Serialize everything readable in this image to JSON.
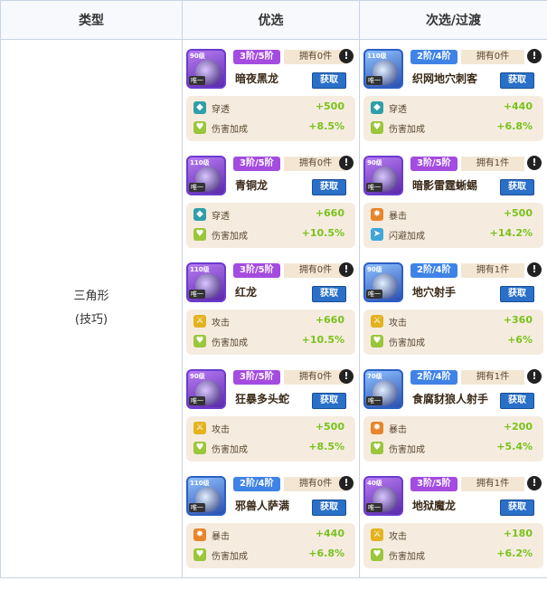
{
  "headers": {
    "type": "类型",
    "preferred": "优选",
    "alternative": "次选/过渡"
  },
  "type_label": {
    "line1": "三角形",
    "line2": "(技巧)"
  },
  "preferred": [
    {
      "level": "90级",
      "rank": "唯一",
      "tier": "3阶/5阶",
      "tier_color": "purple",
      "own": "拥有0件",
      "name": "暗夜黑龙",
      "get": "获取",
      "stats": [
        {
          "icon": "pierce-icon",
          "kind": "pen",
          "label": "穿透",
          "value": "+500"
        },
        {
          "icon": "damage-bonus-icon",
          "kind": "dmg",
          "label": "伤害加成",
          "value": "+8.5%"
        }
      ]
    },
    {
      "level": "110级",
      "rank": "唯一",
      "tier": "3阶/5阶",
      "tier_color": "purple",
      "own": "拥有0件",
      "name": "青铜龙",
      "get": "获取",
      "stats": [
        {
          "icon": "pierce-icon",
          "kind": "pen",
          "label": "穿透",
          "value": "+660"
        },
        {
          "icon": "damage-bonus-icon",
          "kind": "dmg",
          "label": "伤害加成",
          "value": "+10.5%"
        }
      ]
    },
    {
      "level": "110级",
      "rank": "唯一",
      "tier": "3阶/5阶",
      "tier_color": "purple",
      "own": "拥有0件",
      "name": "红龙",
      "get": "获取",
      "stats": [
        {
          "icon": "attack-icon",
          "kind": "atk",
          "label": "攻击",
          "value": "+660"
        },
        {
          "icon": "damage-bonus-icon",
          "kind": "dmg",
          "label": "伤害加成",
          "value": "+10.5%"
        }
      ]
    },
    {
      "level": "90级",
      "rank": "唯一",
      "tier": "3阶/5阶",
      "tier_color": "purple",
      "own": "拥有0件",
      "name": "狂暴多头蛇",
      "get": "获取",
      "stats": [
        {
          "icon": "attack-icon",
          "kind": "atk",
          "label": "攻击",
          "value": "+500"
        },
        {
          "icon": "damage-bonus-icon",
          "kind": "dmg",
          "label": "伤害加成",
          "value": "+8.5%"
        }
      ]
    },
    {
      "level": "110级",
      "rank": "唯一",
      "tier": "2阶/4阶",
      "tier_color": "blue",
      "own": "拥有0件",
      "name": "邪兽人萨满",
      "get": "获取",
      "stats": [
        {
          "icon": "crit-icon",
          "kind": "crit",
          "label": "暴击",
          "value": "+440"
        },
        {
          "icon": "damage-bonus-icon",
          "kind": "dmg",
          "label": "伤害加成",
          "value": "+6.8%"
        }
      ]
    }
  ],
  "alternative": [
    {
      "level": "110级",
      "rank": "唯一",
      "tier": "2阶/4阶",
      "tier_color": "blue",
      "own": "拥有0件",
      "name": "织网地穴刺客",
      "get": "获取",
      "stats": [
        {
          "icon": "pierce-icon",
          "kind": "pen",
          "label": "穿透",
          "value": "+440"
        },
        {
          "icon": "damage-bonus-icon",
          "kind": "dmg",
          "label": "伤害加成",
          "value": "+6.8%"
        }
      ]
    },
    {
      "level": "90级",
      "rank": "唯一",
      "tier": "3阶/5阶",
      "tier_color": "purple",
      "own": "拥有1件",
      "name": "暗影雷霆蜥蜴",
      "get": "获取",
      "stats": [
        {
          "icon": "crit-icon",
          "kind": "crit",
          "label": "暴击",
          "value": "+500"
        },
        {
          "icon": "dodge-bonus-icon",
          "kind": "dodge",
          "label": "闪避加成",
          "value": "+14.2%"
        }
      ]
    },
    {
      "level": "90级",
      "rank": "唯一",
      "tier": "2阶/4阶",
      "tier_color": "blue",
      "own": "拥有1件",
      "name": "地穴射手",
      "get": "获取",
      "stats": [
        {
          "icon": "attack-icon",
          "kind": "atk",
          "label": "攻击",
          "value": "+360"
        },
        {
          "icon": "damage-bonus-icon",
          "kind": "dmg",
          "label": "伤害加成",
          "value": "+6%"
        }
      ]
    },
    {
      "level": "70级",
      "rank": "唯一",
      "tier": "2阶/4阶",
      "tier_color": "blue",
      "own": "拥有1件",
      "name": "食腐豺狼人射手",
      "get": "获取",
      "stats": [
        {
          "icon": "crit-icon",
          "kind": "crit",
          "label": "暴击",
          "value": "+200"
        },
        {
          "icon": "damage-bonus-icon",
          "kind": "dmg",
          "label": "伤害加成",
          "value": "+5.4%"
        }
      ]
    },
    {
      "level": "40级",
      "rank": "唯一",
      "tier": "3阶/5阶",
      "tier_color": "purple",
      "own": "拥有1件",
      "name": "地狱魔龙",
      "get": "获取",
      "stats": [
        {
          "icon": "attack-icon",
          "kind": "atk",
          "label": "攻击",
          "value": "+180"
        },
        {
          "icon": "damage-bonus-icon",
          "kind": "dmg",
          "label": "伤害加成",
          "value": "+6.2%"
        }
      ]
    }
  ]
}
